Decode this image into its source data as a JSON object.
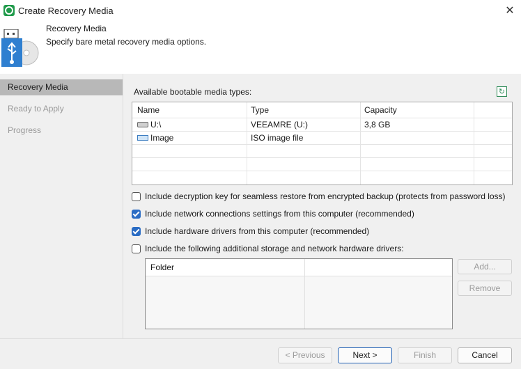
{
  "window": {
    "title": "Create Recovery Media",
    "close_icon": "close-icon"
  },
  "header": {
    "title": "Recovery Media",
    "subtitle": "Specify bare metal recovery media options."
  },
  "sidebar": {
    "steps": [
      {
        "label": "Recovery Media",
        "active": true
      },
      {
        "label": "Ready to Apply",
        "active": false
      },
      {
        "label": "Progress",
        "active": false
      }
    ]
  },
  "media": {
    "label": "Available bootable media types:",
    "columns": [
      "Name",
      "Type",
      "Capacity"
    ],
    "rows": [
      {
        "name": "U:\\",
        "type": "VEEAMRE (U:)",
        "capacity": "3,8 GB",
        "icon": "drive-icon"
      },
      {
        "name": "Image",
        "type": "ISO image file",
        "capacity": "",
        "icon": "iso-image-icon"
      }
    ]
  },
  "options": [
    {
      "label": "Include decryption key for seamless restore from encrypted backup (protects from password loss)",
      "checked": false
    },
    {
      "label": "Include network connections settings from this computer (recommended)",
      "checked": true
    },
    {
      "label": "Include hardware drivers from this computer (recommended)",
      "checked": true
    },
    {
      "label": "Include the following additional storage and network hardware drivers:",
      "checked": false
    }
  ],
  "drivers": {
    "columns": [
      "Folder"
    ],
    "add_label": "Add...",
    "remove_label": "Remove"
  },
  "footer": {
    "previous": "< Previous",
    "next": "Next >",
    "finish": "Finish",
    "cancel": "Cancel"
  },
  "colors": {
    "accent": "#2a6cc4",
    "brand_green": "#1f9a4a"
  }
}
